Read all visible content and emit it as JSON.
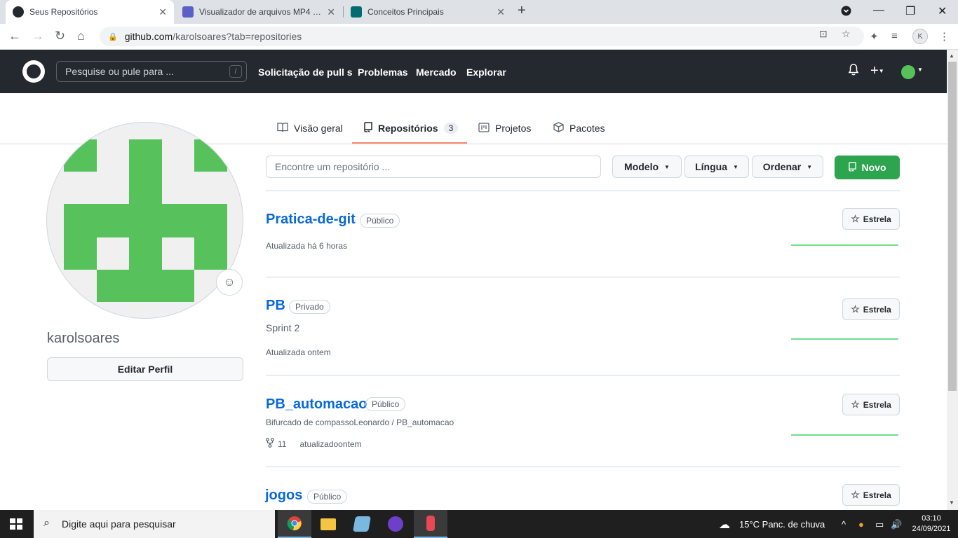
{
  "browser": {
    "tabs": [
      {
        "title": "Seus Repositórios",
        "color": "#24292f"
      },
      {
        "title": "Visualizador de arquivos MP4 | M",
        "color": "#5b5fc7"
      },
      {
        "title": "Conceitos Principais",
        "color": "#036c70"
      }
    ],
    "url_host": "github.com",
    "url_path": "/karolsoares?tab=repositories",
    "profile_initial": "K"
  },
  "github_header": {
    "search_placeholder": "Pesquise ou pule para ...",
    "search_shortcut": "/",
    "nav": [
      "Solicitação de pull s",
      "Problemas",
      "Mercado",
      "Explorar"
    ]
  },
  "profile_tabs": [
    {
      "label": "Visão geral",
      "icon": "book-icon"
    },
    {
      "label": "Repositórios",
      "icon": "repo-icon",
      "count": "3"
    },
    {
      "label": "Projetos",
      "icon": "project-icon"
    },
    {
      "label": "Pacotes",
      "icon": "package-icon"
    }
  ],
  "profile": {
    "username": "karolsoares",
    "edit_label": "Editar Perfil",
    "avatar_color": "#57c15b"
  },
  "filters": {
    "search_placeholder": "Encontre um repositório ...",
    "type_label": "Modelo",
    "language_label": "Língua",
    "sort_label": "Ordenar",
    "new_label": "Novo"
  },
  "repos": [
    {
      "name": "Pratica-de-git",
      "visibility": "Público",
      "updated": "Atualizada há 6 horas",
      "star_label": "Estrela"
    },
    {
      "name": "PB",
      "visibility": "Privado",
      "description": "Sprint 2",
      "updated": "Atualizada ontem",
      "star_label": "Estrela"
    },
    {
      "name": "PB_automacao",
      "visibility": "Público",
      "forked_from": "Bifurcado de compassoLeonardo / PB_automacao",
      "forks": "11",
      "updated": "atualizadoontem",
      "star_label": "Estrela"
    },
    {
      "name": "jogos",
      "visibility": "Público",
      "star_label": "Estrela"
    }
  ],
  "taskbar": {
    "search_placeholder": "Digite aqui para pesquisar",
    "weather": "15°C  Panc. de chuva",
    "time": "03:10",
    "date": "24/09/2021"
  }
}
